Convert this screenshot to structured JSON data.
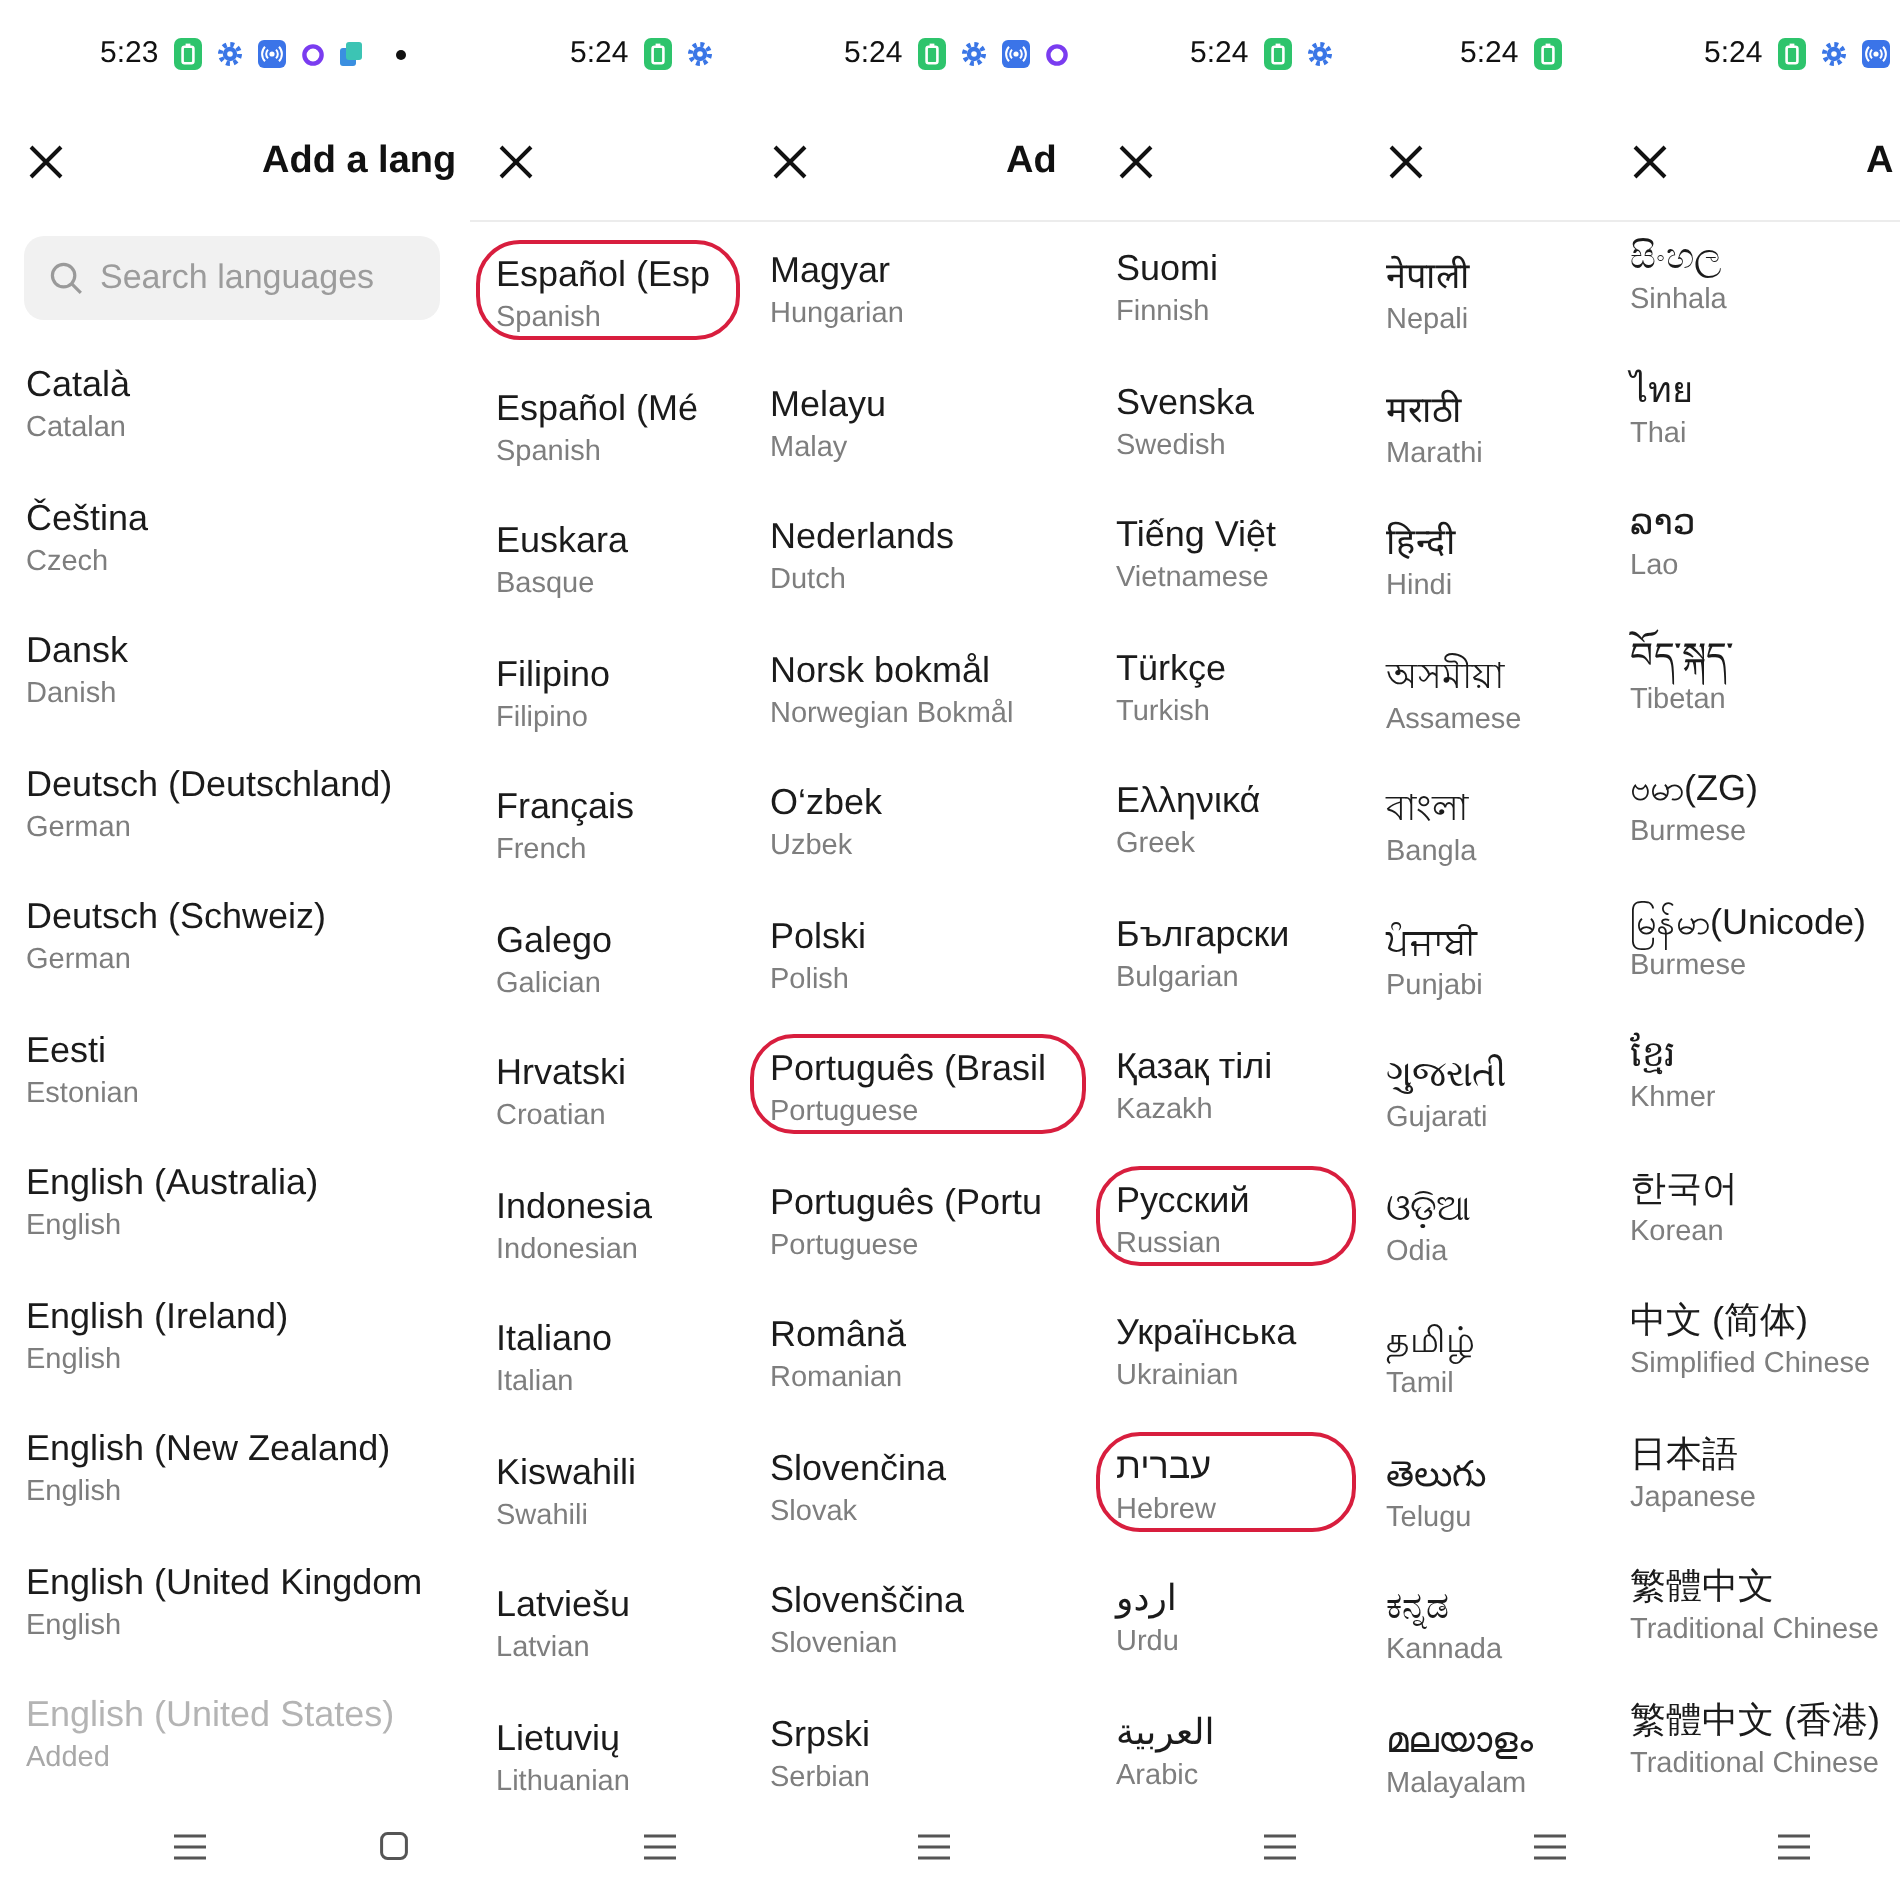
{
  "panels": [
    {
      "status_bar": {
        "time": "5:23",
        "icons": [
          {
            "kind": "battery"
          },
          {
            "kind": "gear"
          },
          {
            "kind": "broadcast"
          },
          {
            "kind": "ring"
          },
          {
            "kind": "app"
          },
          {
            "kind": "dot"
          }
        ]
      },
      "title": "Add a lang",
      "search": {
        "placeholder": "Search languages"
      },
      "languages": [
        {
          "name": "Català",
          "english": "Catalan",
          "disabled": false,
          "circled": false
        },
        {
          "name": "Čeština",
          "english": "Czech",
          "disabled": false,
          "circled": false
        },
        {
          "name": "Dansk",
          "english": "Danish",
          "disabled": false,
          "circled": false
        },
        {
          "name": "Deutsch (Deutschland)",
          "english": "German",
          "disabled": false,
          "circled": false
        },
        {
          "name": "Deutsch (Schweiz)",
          "english": "German",
          "disabled": false,
          "circled": false
        },
        {
          "name": "Eesti",
          "english": "Estonian",
          "disabled": false,
          "circled": false
        },
        {
          "name": "English (Australia)",
          "english": "English",
          "disabled": false,
          "circled": false
        },
        {
          "name": "English (Ireland)",
          "english": "English",
          "disabled": false,
          "circled": false
        },
        {
          "name": "English (New Zealand)",
          "english": "English",
          "disabled": false,
          "circled": false
        },
        {
          "name": "English (United Kingdom",
          "english": "English",
          "disabled": false,
          "circled": false
        },
        {
          "name": "English (United States)",
          "english": "Added",
          "disabled": true,
          "circled": false
        }
      ],
      "nav_bar": [
        {
          "kind": "menu"
        },
        {
          "kind": "home"
        }
      ]
    },
    {
      "status_bar": {
        "time": "5:24",
        "icons": [
          {
            "kind": "battery"
          },
          {
            "kind": "gear"
          }
        ]
      },
      "languages": [
        {
          "name": "Español (Esp",
          "english": "Spanish",
          "disabled": false,
          "circled": true
        },
        {
          "name": "Español (Mé",
          "english": "Spanish",
          "disabled": false,
          "circled": false
        },
        {
          "name": "Euskara",
          "english": "Basque",
          "disabled": false,
          "circled": false
        },
        {
          "name": "Filipino",
          "english": "Filipino",
          "disabled": false,
          "circled": false
        },
        {
          "name": "Français",
          "english": "French",
          "disabled": false,
          "circled": false
        },
        {
          "name": "Galego",
          "english": "Galician",
          "disabled": false,
          "circled": false
        },
        {
          "name": "Hrvatski",
          "english": "Croatian",
          "disabled": false,
          "circled": false
        },
        {
          "name": "Indonesia",
          "english": "Indonesian",
          "disabled": false,
          "circled": false
        },
        {
          "name": "Italiano",
          "english": "Italian",
          "disabled": false,
          "circled": false
        },
        {
          "name": "Kiswahili",
          "english": "Swahili",
          "disabled": false,
          "circled": false
        },
        {
          "name": "Latviešu",
          "english": "Latvian",
          "disabled": false,
          "circled": false
        },
        {
          "name": "Lietuvių",
          "english": "Lithuanian",
          "disabled": false,
          "circled": false
        }
      ],
      "nav_bar": [
        {
          "kind": "menu"
        }
      ]
    },
    {
      "status_bar": {
        "time": "5:24",
        "icons": [
          {
            "kind": "battery"
          },
          {
            "kind": "gear"
          },
          {
            "kind": "broadcast"
          },
          {
            "kind": "ring"
          }
        ]
      },
      "title": "Ad",
      "languages": [
        {
          "name": "Magyar",
          "english": "Hungarian",
          "disabled": false,
          "circled": false
        },
        {
          "name": "Melayu",
          "english": "Malay",
          "disabled": false,
          "circled": false
        },
        {
          "name": "Nederlands",
          "english": "Dutch",
          "disabled": false,
          "circled": false
        },
        {
          "name": "Norsk bokmål",
          "english": "Norwegian Bokmål",
          "disabled": false,
          "circled": false
        },
        {
          "name": "O‘zbek",
          "english": "Uzbek",
          "disabled": false,
          "circled": false
        },
        {
          "name": "Polski",
          "english": "Polish",
          "disabled": false,
          "circled": false
        },
        {
          "name": "Português (Brasil",
          "english": "Portuguese",
          "disabled": false,
          "circled": true
        },
        {
          "name": "Português (Portu",
          "english": "Portuguese",
          "disabled": false,
          "circled": false
        },
        {
          "name": "Română",
          "english": "Romanian",
          "disabled": false,
          "circled": false
        },
        {
          "name": "Slovenčina",
          "english": "Slovak",
          "disabled": false,
          "circled": false
        },
        {
          "name": "Slovenščina",
          "english": "Slovenian",
          "disabled": false,
          "circled": false
        },
        {
          "name": "Srpski",
          "english": "Serbian",
          "disabled": false,
          "circled": false
        }
      ],
      "nav_bar": [
        {
          "kind": "menu"
        }
      ]
    },
    {
      "status_bar": {
        "time": "5:24",
        "icons": [
          {
            "kind": "battery"
          },
          {
            "kind": "gear"
          }
        ]
      },
      "languages": [
        {
          "name": "Suomi",
          "english": "Finnish",
          "disabled": false,
          "circled": false
        },
        {
          "name": "Svenska",
          "english": "Swedish",
          "disabled": false,
          "circled": false
        },
        {
          "name": "Tiếng Việt",
          "english": "Vietnamese",
          "disabled": false,
          "circled": false
        },
        {
          "name": "Türkçe",
          "english": "Turkish",
          "disabled": false,
          "circled": false
        },
        {
          "name": "Ελληνικά",
          "english": "Greek",
          "disabled": false,
          "circled": false
        },
        {
          "name": "Български",
          "english": "Bulgarian",
          "disabled": false,
          "circled": false
        },
        {
          "name": "Қазақ тілі",
          "english": "Kazakh",
          "disabled": false,
          "circled": false
        },
        {
          "name": "Русский",
          "english": "Russian",
          "disabled": false,
          "circled": true
        },
        {
          "name": "Українська",
          "english": "Ukrainian",
          "disabled": false,
          "circled": false
        },
        {
          "name": "עברית",
          "english": "Hebrew",
          "disabled": false,
          "circled": true
        },
        {
          "name": "اردو",
          "english": "Urdu",
          "disabled": false,
          "circled": false
        },
        {
          "name": "العربية",
          "english": "Arabic",
          "disabled": false,
          "circled": false
        }
      ],
      "nav_bar": [
        {
          "kind": "menu"
        }
      ]
    },
    {
      "status_bar": {
        "time": "5:24",
        "icons": [
          {
            "kind": "battery"
          }
        ]
      },
      "languages": [
        {
          "name": "नेपाली",
          "english": "Nepali",
          "disabled": false,
          "circled": false
        },
        {
          "name": "मराठी",
          "english": "Marathi",
          "disabled": false,
          "circled": false
        },
        {
          "name": "हिन्दी",
          "english": "Hindi",
          "disabled": false,
          "circled": false
        },
        {
          "name": "অসমীয়া",
          "english": "Assamese",
          "disabled": false,
          "circled": false
        },
        {
          "name": "বাংলা",
          "english": "Bangla",
          "disabled": false,
          "circled": false
        },
        {
          "name": "ਪੰਜਾਬੀ",
          "english": "Punjabi",
          "disabled": false,
          "circled": false
        },
        {
          "name": "ગુજરાતી",
          "english": "Gujarati",
          "disabled": false,
          "circled": false
        },
        {
          "name": "ଓଡ଼ିଆ",
          "english": "Odia",
          "disabled": false,
          "circled": false
        },
        {
          "name": "தமிழ்",
          "english": "Tamil",
          "disabled": false,
          "circled": false
        },
        {
          "name": "తెలుగు",
          "english": "Telugu",
          "disabled": false,
          "circled": false
        },
        {
          "name": "ಕನ್ನಡ",
          "english": "Kannada",
          "disabled": false,
          "circled": false
        },
        {
          "name": "മലയാളം",
          "english": "Malayalam",
          "disabled": false,
          "circled": false
        }
      ],
      "nav_bar": [
        {
          "kind": "menu"
        }
      ]
    },
    {
      "status_bar": {
        "time": "5:24",
        "icons": [
          {
            "kind": "battery"
          },
          {
            "kind": "gear"
          },
          {
            "kind": "broadcast"
          }
        ]
      },
      "title": "A",
      "languages": [
        {
          "name": "සිංහල",
          "english": "Sinhala",
          "disabled": false,
          "circled": false
        },
        {
          "name": "ไทย",
          "english": "Thai",
          "disabled": false,
          "circled": false
        },
        {
          "name": "ລາວ",
          "english": "Lao",
          "disabled": false,
          "circled": false
        },
        {
          "name": "བོད་སྐད་",
          "english": "Tibetan",
          "disabled": false,
          "circled": false
        },
        {
          "name": "ဗမာ(ZG)",
          "english": "Burmese",
          "disabled": false,
          "circled": false
        },
        {
          "name": "မြန်မာ(Unicode)",
          "english": "Burmese",
          "disabled": false,
          "circled": false
        },
        {
          "name": "ខ្មែរ",
          "english": "Khmer",
          "disabled": false,
          "circled": false
        },
        {
          "name": "한국어",
          "english": "Korean",
          "disabled": false,
          "circled": false
        },
        {
          "name": "中文 (简体)",
          "english": "Simplified Chinese",
          "disabled": false,
          "circled": false
        },
        {
          "name": "日本語",
          "english": "Japanese",
          "disabled": false,
          "circled": false
        },
        {
          "name": "繁體中文",
          "english": "Traditional Chinese",
          "disabled": false,
          "circled": false
        },
        {
          "name": "繁體中文 (香港)",
          "english": "Traditional Chinese",
          "disabled": false,
          "circled": false
        }
      ],
      "nav_bar": [
        {
          "kind": "menu"
        }
      ]
    }
  ]
}
